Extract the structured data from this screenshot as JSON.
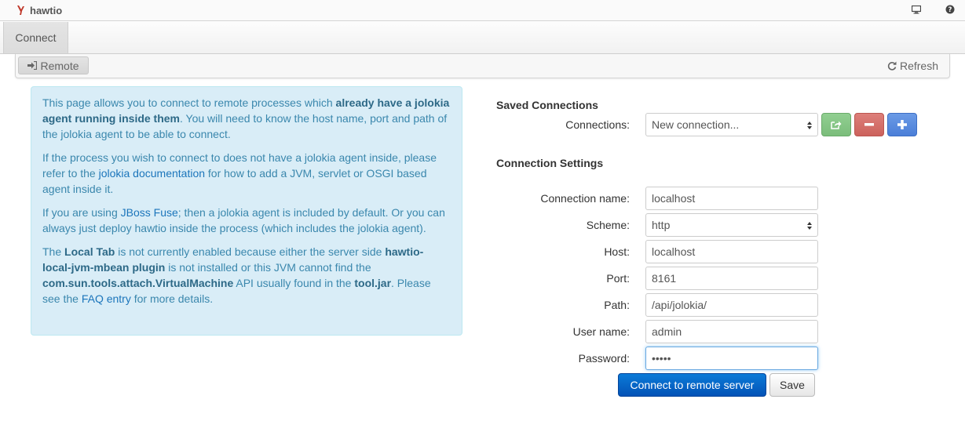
{
  "app": {
    "title": "hawtio"
  },
  "tabs": [
    {
      "label": "Connect"
    }
  ],
  "toolbar": {
    "remote_label": "Remote",
    "refresh_label": "Refresh"
  },
  "info": {
    "p1": {
      "t1": "This page allows you to connect to remote processes which ",
      "b1": "already have a jolokia agent running inside them",
      "t2": ". You will need to know the host name, port and path of the jolokia agent to be able to connect."
    },
    "p2": {
      "t1": "If the process you wish to connect to does not have a jolokia agent inside, please refer to the ",
      "link": "jolokia documentation",
      "t2": " for how to add a JVM, servlet or OSGI based agent inside it."
    },
    "p3": {
      "t1": "If you are using ",
      "link": "JBoss Fuse",
      "t2": "; then a jolokia agent is included by default. Or you can always just deploy hawtio inside the process (which includes the jolokia agent)."
    },
    "p4": {
      "t1": "The ",
      "b1": "Local Tab",
      "t2": " is not currently enabled because either the server side ",
      "b2": "hawtio-local-jvm-mbean plugin",
      "t3": " is not installed or this JVM cannot find the ",
      "b3": "com.sun.tools.attach.VirtualMachine",
      "t4": " API usually found in the ",
      "b4": "tool.jar",
      "t5": ". Please see the ",
      "link": "FAQ entry",
      "t6": " for more details."
    }
  },
  "saved": {
    "title": "Saved Connections",
    "connections_label": "Connections:",
    "connections_value": "New connection..."
  },
  "settings": {
    "title": "Connection Settings",
    "name_label": "Connection name:",
    "name_value": "localhost",
    "scheme_label": "Scheme:",
    "scheme_value": "http",
    "host_label": "Host:",
    "host_value": "localhost",
    "port_label": "Port:",
    "port_value": "8161",
    "path_label": "Path:",
    "path_value": "/api/jolokia/",
    "user_label": "User name:",
    "user_value": "admin",
    "password_label": "Password:",
    "password_value": "•••••"
  },
  "actions": {
    "connect_label": "Connect to remote server",
    "save_label": "Save"
  },
  "colors": {
    "primary": "#0352b6",
    "info_bg": "#d9edf7",
    "info_text": "#3a87ad",
    "success": "#7bbd7b",
    "danger": "#cc625c",
    "accent_blue": "#4b7fd8"
  },
  "icons": {
    "brand": "hawtio-logo-icon",
    "monitor": "monitor-icon",
    "help": "help-icon",
    "remote": "sign-in-icon",
    "refresh": "refresh-icon",
    "share": "share-icon",
    "remove": "minus-icon",
    "add": "plus-icon"
  }
}
